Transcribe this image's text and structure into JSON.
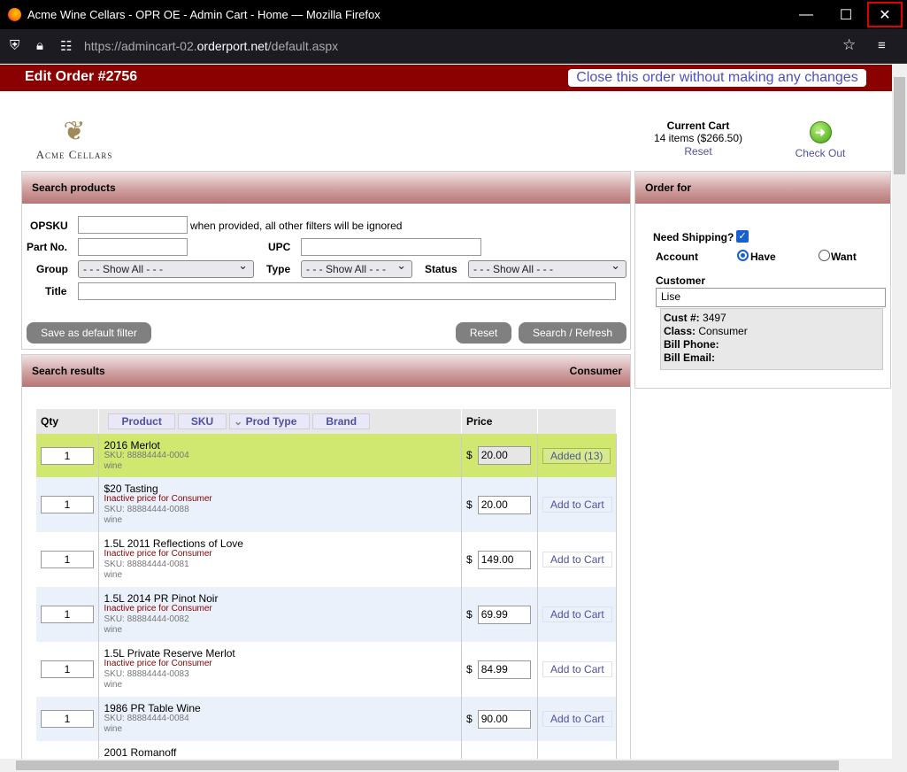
{
  "window": {
    "title": "Acme Wine Cellars - OPR OE - Admin Cart - Home — Mozilla Firefox",
    "minimize": "—",
    "maximize": "☐",
    "close": "✕"
  },
  "browser": {
    "url_prefix": "https://admincart-02.",
    "url_domain": "orderport.net",
    "url_suffix": "/default.aspx"
  },
  "header": {
    "title": "Edit Order #2756",
    "close_link": "Close this order without making any changes"
  },
  "logo": {
    "name": "Acme Cellars"
  },
  "cart": {
    "title": "Current Cart",
    "summary": "14 items ($266.50)",
    "reset": "Reset",
    "checkout": "Check Out"
  },
  "search": {
    "title": "Search products",
    "opsku_label": "OPSKU",
    "opsku_note": "when provided, all other filters will be ignored",
    "partno_label": "Part No.",
    "upc_label": "UPC",
    "group_label": "Group",
    "group_value": "- - - Show All - - -",
    "type_label": "Type",
    "type_value": "- - - Show All - - -",
    "status_label": "Status",
    "status_value": "- - - Show All - - -",
    "title_label": "Title",
    "save_default": "Save as default filter",
    "reset": "Reset",
    "search": "Search / Refresh"
  },
  "results": {
    "title": "Search results",
    "price_class": "Consumer",
    "columns": {
      "qty": "Qty",
      "product": "Product",
      "sku": "SKU",
      "prod_type": "Prod Type",
      "brand": "Brand",
      "price": "Price"
    },
    "currency": "$",
    "rows": [
      {
        "qty": "1",
        "name": "2016 Merlot",
        "inactive": "",
        "sku": "SKU: 88884444-0004",
        "type": "wine",
        "price": "20.00",
        "action": "Added (13)"
      },
      {
        "qty": "1",
        "name": "$20 Tasting",
        "inactive": "Inactive price for Consumer",
        "sku": "SKU: 88884444-0088",
        "type": "wine",
        "price": "20.00",
        "action": "Add to Cart"
      },
      {
        "qty": "1",
        "name": "1.5L 2011 Reflections of Love",
        "inactive": "Inactive price for Consumer",
        "sku": "SKU: 88884444-0081",
        "type": "wine",
        "price": "149.00",
        "action": "Add to Cart"
      },
      {
        "qty": "1",
        "name": "1.5L 2014 PR Pinot Noir",
        "inactive": "Inactive price for Consumer",
        "sku": "SKU: 88884444-0082",
        "type": "wine",
        "price": "69.99",
        "action": "Add to Cart"
      },
      {
        "qty": "1",
        "name": "1.5L Private Reserve Merlot",
        "inactive": "Inactive price for Consumer",
        "sku": "SKU: 88884444-0083",
        "type": "wine",
        "price": "84.99",
        "action": "Add to Cart"
      },
      {
        "qty": "1",
        "name": "1986 PR Table Wine",
        "inactive": "",
        "sku": "SKU: 88884444-0084",
        "type": "wine",
        "price": "90.00",
        "action": "Add to Cart"
      },
      {
        "qty": "",
        "name": "2001 Romanoff",
        "inactive": "",
        "sku": "",
        "type": "",
        "price": "",
        "action": ""
      }
    ]
  },
  "order_for": {
    "title": "Order for",
    "need_shipping": "Need Shipping?",
    "account_label": "Account",
    "have": "Have",
    "want": "Want",
    "customer_label": "Customer",
    "customer_value": "Lise",
    "cust_no_label": "Cust #:",
    "cust_no": "3497",
    "class_label": "Class:",
    "class_value": "Consumer",
    "bill_phone_label": "Bill Phone:",
    "bill_email_label": "Bill Email:"
  }
}
